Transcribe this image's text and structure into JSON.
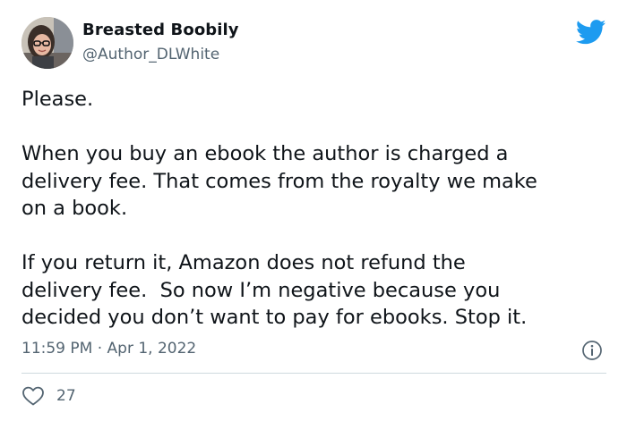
{
  "author": {
    "display_name": "Breasted Boobily",
    "handle": "@Author_DLWhite"
  },
  "tweet": {
    "text": "Please.\n\nWhen you buy an ebook the author is charged a\ndelivery fee. That comes from the royalty we make\non a book.\n\nIf you return it, Amazon does not refund the\ndelivery fee.  So now I’m negative because you\ndecided you don’t want to pay for ebooks. Stop it.",
    "time": "11:59 PM",
    "separator": "·",
    "date": "Apr 1, 2022"
  },
  "actions": {
    "like_count": "27"
  },
  "icons": {
    "brand": "twitter-bird-icon",
    "info": "info-icon",
    "like": "heart-icon"
  },
  "colors": {
    "brand_blue": "#1d9bf0",
    "secondary_text": "#536471",
    "primary_text": "#0f1419",
    "divider": "#cfd9de"
  }
}
